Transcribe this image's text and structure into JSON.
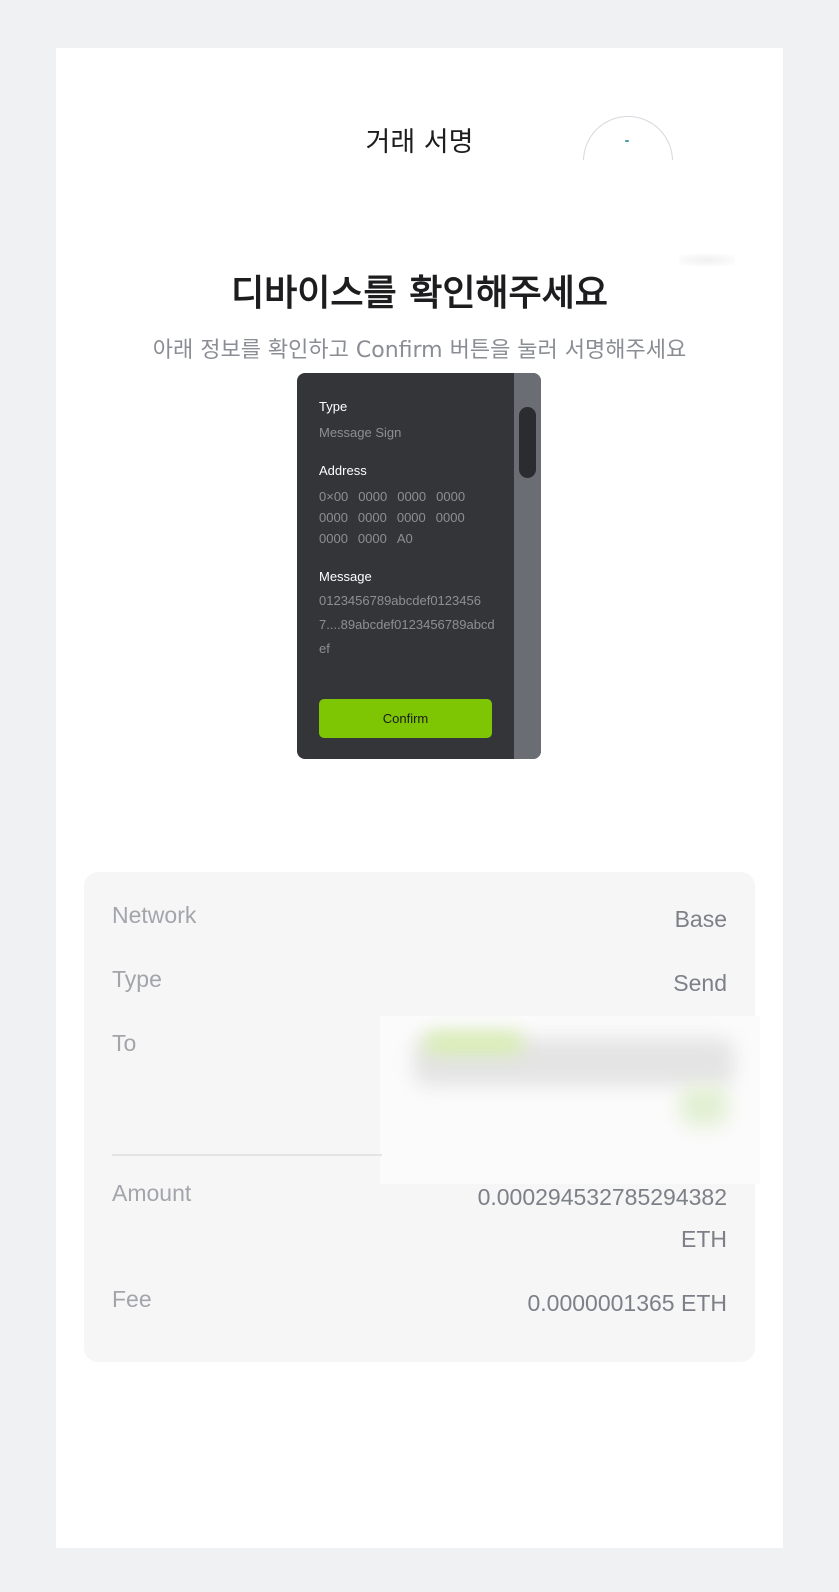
{
  "header": {
    "title": "거래 서명"
  },
  "hero": {
    "title": "디바이스를 확인해주세요",
    "subtitle": "아래 정보를 확인하고 Confirm 버튼을 눌러 서명해주세요"
  },
  "device": {
    "type_label": "Type",
    "type_value": "Message Sign",
    "address_label": "Address",
    "address_rows": [
      [
        "0×00",
        "0000",
        "0000",
        "0000"
      ],
      [
        "0000",
        "0000",
        "0000",
        "0000"
      ],
      [
        "0000",
        "0000",
        "A0"
      ]
    ],
    "message_label": "Message",
    "message_value": "0123456789abcdef01234567....89abcdef0123456789abcdef",
    "confirm_label": "Confirm",
    "confirm_color": "#7ec603"
  },
  "details": {
    "network_label": "Network",
    "network_value": "Base",
    "type_label": "Type",
    "type_value": "Send",
    "to_label": "To",
    "amount_label": "Amount",
    "amount_value_line1": "0.000294532785294382",
    "amount_value_line2": "ETH",
    "fee_label": "Fee",
    "fee_value": "0.0000001365 ETH"
  }
}
